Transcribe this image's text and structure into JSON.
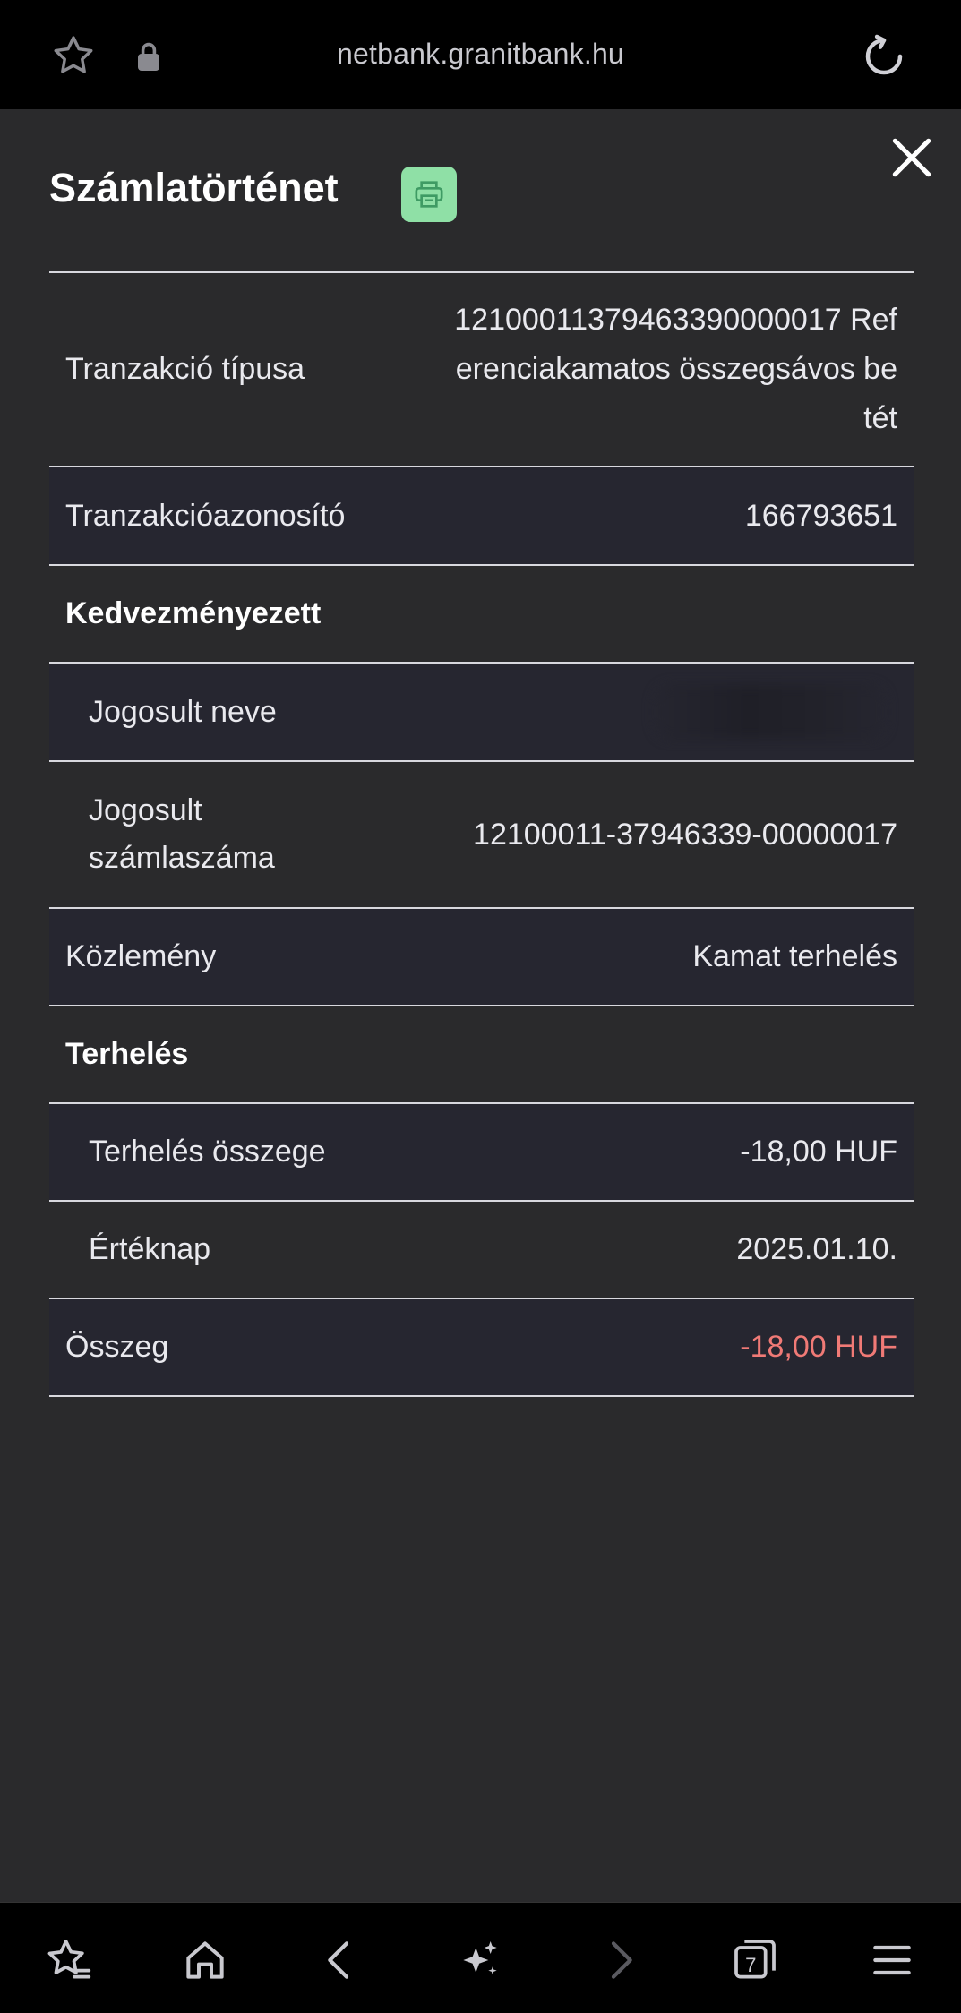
{
  "browser": {
    "url": "netbank.granitbank.hu",
    "tab_count": "7"
  },
  "page": {
    "title": "Számlatörténet"
  },
  "details": {
    "transaction_type_label": "Tranzakció típusa",
    "transaction_type_value": "12100011379463390000017 Referenciakamatos összegsávos betét",
    "transaction_id_label": "Tranzakcióazonosító",
    "transaction_id_value": "166793651",
    "beneficiary_heading": "Kedvezményezett",
    "beneficiary_name_label": "Jogosult neve",
    "beneficiary_account_label": "Jogosult számlaszáma",
    "beneficiary_account_value": "12100011-37946339-00000017",
    "memo_label": "Közlemény",
    "memo_value": "Kamat terhelés",
    "debit_heading": "Terhelés",
    "debit_amount_label": "Terhelés összege",
    "debit_amount_value": "-18,00 HUF",
    "value_date_label": "Értéknap",
    "value_date_value": "2025.01.10.",
    "total_label": "Összeg",
    "total_value": "-18,00 HUF"
  },
  "colors": {
    "background": "#2a2a2c",
    "print_button": "#8fe0a6",
    "negative_amount": "#f07a76"
  },
  "icons": [
    "star-icon",
    "lock-icon",
    "reload-icon",
    "close-icon",
    "printer-icon",
    "bookmarks-icon",
    "home-icon",
    "back-icon",
    "ai-sparkle-icon",
    "forward-icon",
    "tabs-icon",
    "menu-icon"
  ]
}
